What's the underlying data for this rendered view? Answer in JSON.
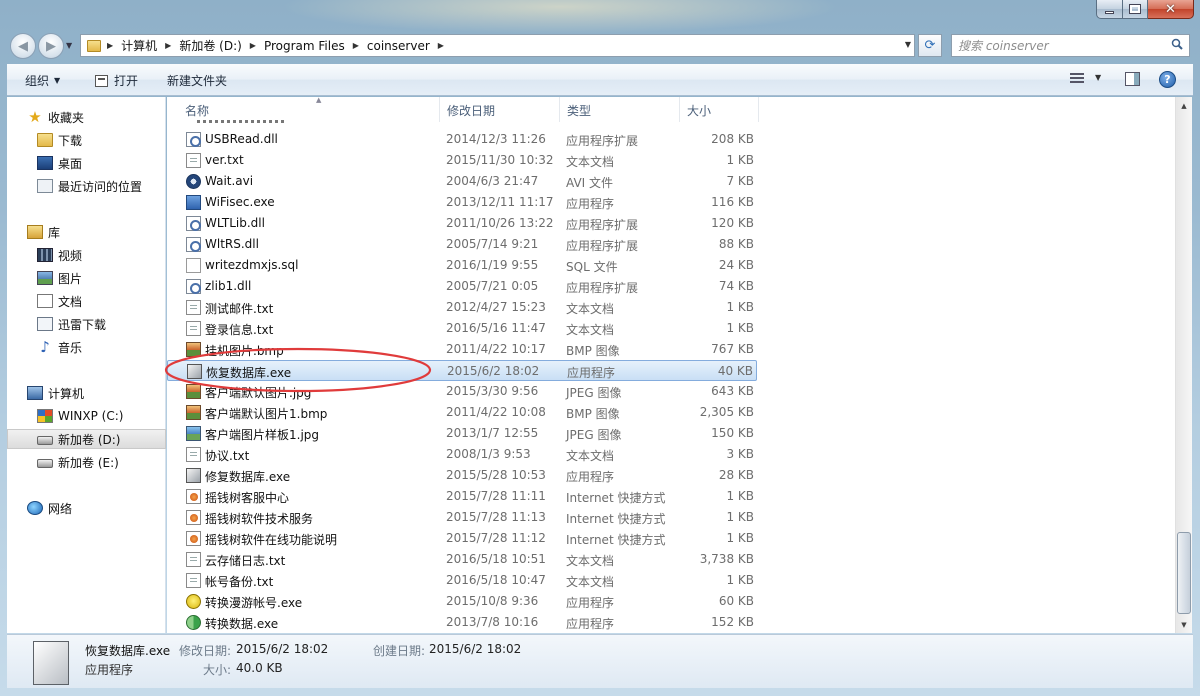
{
  "window": {
    "caption_min": "—",
    "caption_max": "□",
    "caption_close": "✕"
  },
  "address": {
    "crumbs": [
      "计算机",
      "新加卷 (D:)",
      "Program Files",
      "coinserver"
    ]
  },
  "search": {
    "placeholder": "搜索 coinserver"
  },
  "toolbar": {
    "organize": "组织",
    "open": "打开",
    "new_folder": "新建文件夹"
  },
  "nav": {
    "favorites": "收藏夹",
    "downloads": "下载",
    "desktop": "桌面",
    "recent": "最近访问的位置",
    "libraries": "库",
    "videos": "视频",
    "pictures": "图片",
    "documents": "文档",
    "thunder": "迅雷下载",
    "music": "音乐",
    "computer": "计算机",
    "drive_c": "WINXP (C:)",
    "drive_d": "新加卷 (D:)",
    "drive_e": "新加卷 (E:)",
    "network": "网络"
  },
  "columns": {
    "name": "名称",
    "date": "修改日期",
    "type": "类型",
    "size": "大小"
  },
  "files": [
    {
      "name": "USBRead.dll",
      "date": "2014/12/3 11:26",
      "type": "应用程序扩展",
      "size": "208 KB",
      "icon": "dll-icon"
    },
    {
      "name": "ver.txt",
      "date": "2015/11/30 10:32",
      "type": "文本文档",
      "size": "1 KB",
      "icon": "text-file-icon"
    },
    {
      "name": "Wait.avi",
      "date": "2004/6/3 21:47",
      "type": "AVI 文件",
      "size": "7 KB",
      "icon": "media-file-icon"
    },
    {
      "name": "WiFisec.exe",
      "date": "2013/12/11 11:17",
      "type": "应用程序",
      "size": "116 KB",
      "icon": "exe-icon"
    },
    {
      "name": "WLTLib.dll",
      "date": "2011/10/26 13:22",
      "type": "应用程序扩展",
      "size": "120 KB",
      "icon": "dll-icon"
    },
    {
      "name": "WltRS.dll",
      "date": "2005/7/14 9:21",
      "type": "应用程序扩展",
      "size": "88 KB",
      "icon": "dll-icon"
    },
    {
      "name": "writezdmxjs.sql",
      "date": "2016/1/19 9:55",
      "type": "SQL 文件",
      "size": "24 KB",
      "icon": "sql-file-icon"
    },
    {
      "name": "zlib1.dll",
      "date": "2005/7/21 0:05",
      "type": "应用程序扩展",
      "size": "74 KB",
      "icon": "dll-icon"
    },
    {
      "name": "测试邮件.txt",
      "date": "2012/4/27 15:23",
      "type": "文本文档",
      "size": "1 KB",
      "icon": "text-file-icon"
    },
    {
      "name": "登录信息.txt",
      "date": "2016/5/16 11:47",
      "type": "文本文档",
      "size": "1 KB",
      "icon": "text-file-icon"
    },
    {
      "name": "挂机图片.bmp",
      "date": "2011/4/22 10:17",
      "type": "BMP 图像",
      "size": "767 KB",
      "icon": "image-file-icon"
    },
    {
      "name": "恢复数据库.exe",
      "date": "2015/6/2 18:02",
      "type": "应用程序",
      "size": "40 KB",
      "icon": "exe-generic-icon",
      "selected": true
    },
    {
      "name": "客户端默认图片.jpg",
      "date": "2015/3/30 9:56",
      "type": "JPEG 图像",
      "size": "643 KB",
      "icon": "image-file-icon"
    },
    {
      "name": "客户端默认图片1.bmp",
      "date": "2011/4/22 10:08",
      "type": "BMP 图像",
      "size": "2,305 KB",
      "icon": "image-file-icon"
    },
    {
      "name": "客户端图片样板1.jpg",
      "date": "2013/1/7 12:55",
      "type": "JPEG 图像",
      "size": "150 KB",
      "icon": "jpeg-file-icon"
    },
    {
      "name": "协议.txt",
      "date": "2008/1/3 9:53",
      "type": "文本文档",
      "size": "3 KB",
      "icon": "text-file-icon"
    },
    {
      "name": "修复数据库.exe",
      "date": "2015/5/28 10:53",
      "type": "应用程序",
      "size": "28 KB",
      "icon": "exe-generic-icon"
    },
    {
      "name": "摇钱树客服中心",
      "date": "2015/7/28 11:11",
      "type": "Internet 快捷方式",
      "size": "1 KB",
      "icon": "shortcut-icon"
    },
    {
      "name": "摇钱树软件技术服务",
      "date": "2015/7/28 11:13",
      "type": "Internet 快捷方式",
      "size": "1 KB",
      "icon": "shortcut-icon"
    },
    {
      "name": "摇钱树软件在线功能说明",
      "date": "2015/7/28 11:12",
      "type": "Internet 快捷方式",
      "size": "1 KB",
      "icon": "shortcut-icon"
    },
    {
      "name": "云存储日志.txt",
      "date": "2016/5/18 10:51",
      "type": "文本文档",
      "size": "3,738 KB",
      "icon": "text-file-icon"
    },
    {
      "name": "帐号备份.txt",
      "date": "2016/5/18 10:47",
      "type": "文本文档",
      "size": "1 KB",
      "icon": "text-file-icon"
    },
    {
      "name": "转换漫游帐号.exe",
      "date": "2015/10/8 9:36",
      "type": "应用程序",
      "size": "60 KB",
      "icon": "smiley-exe-icon"
    },
    {
      "name": "转换数据.exe",
      "date": "2013/7/8 10:16",
      "type": "应用程序",
      "size": "152 KB",
      "icon": "convert-exe-icon"
    }
  ],
  "details": {
    "name": "恢复数据库.exe",
    "type": "应用程序",
    "modified_label": "修改日期:",
    "modified": "2015/6/2 18:02",
    "size_label": "大小:",
    "size": "40.0 KB",
    "created_label": "创建日期:",
    "created": "2015/6/2 18:02"
  },
  "colors": {
    "annotation": "#e03b3b",
    "selection_border": "#84acdd"
  }
}
